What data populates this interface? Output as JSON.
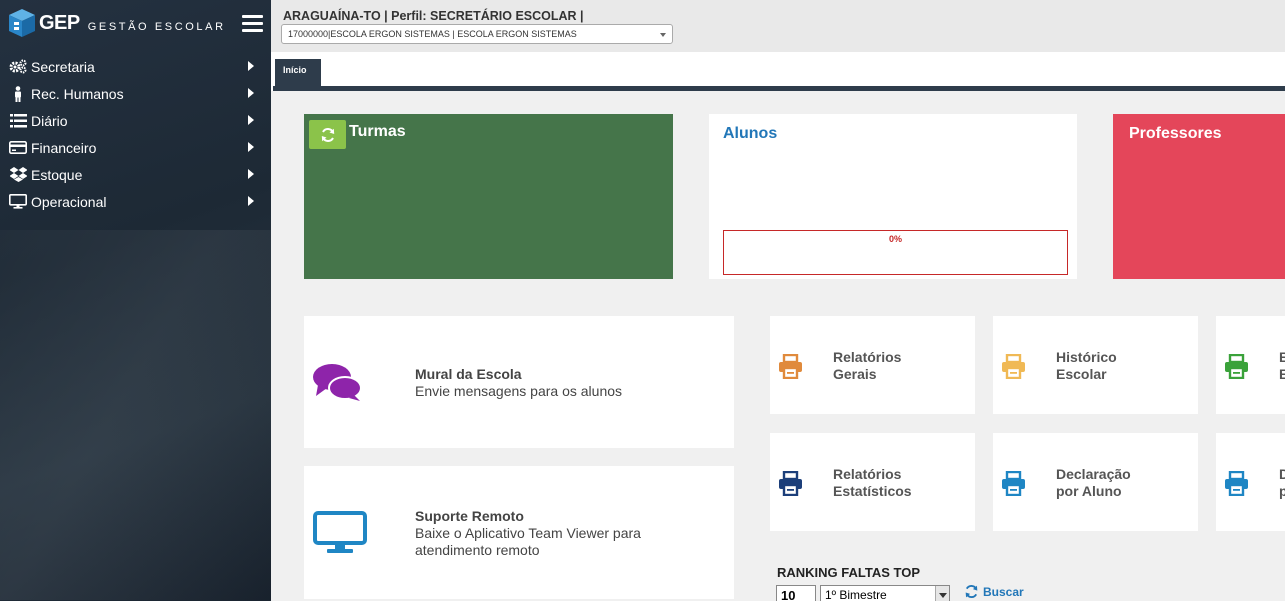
{
  "brand": {
    "logo_text": "GEP",
    "subtitle": "GESTÃO ESCOLAR"
  },
  "sidebar": {
    "items": [
      {
        "label": "Secretaria",
        "icon": "gears-icon"
      },
      {
        "label": "Rec. Humanos",
        "icon": "person-icon"
      },
      {
        "label": "Diário",
        "icon": "list-icon"
      },
      {
        "label": "Financeiro",
        "icon": "credit-card-icon"
      },
      {
        "label": "Estoque",
        "icon": "dropbox-icon"
      },
      {
        "label": "Operacional",
        "icon": "monitor-icon"
      }
    ]
  },
  "header": {
    "context": "ARAGUAÍNA-TO | Perfil: SECRETÁRIO ESCOLAR |",
    "school_select": "17000000|ESCOLA ERGON SISTEMAS | ESCOLA ERGON SISTEMAS"
  },
  "tabs": [
    {
      "label": "Início",
      "active": true
    }
  ],
  "stats": {
    "turmas": {
      "title": "Turmas",
      "color": "#45754a"
    },
    "alunos": {
      "title": "Alunos",
      "progress_label": "0%",
      "progress": 0
    },
    "professores": {
      "title": "Professores",
      "color": "#e4465a"
    }
  },
  "features": {
    "mural": {
      "title": "Mural da Escola",
      "desc": "Envie mensagens para os alunos"
    },
    "suporte": {
      "title": "Suporte Remoto",
      "desc": "Baixe o Aplicativo Team Viewer para atendimento remoto"
    }
  },
  "reports": [
    {
      "line1": "Relatórios",
      "line2": "Gerais",
      "color": "#e08a3c"
    },
    {
      "line1": "Histórico",
      "line2": "Escolar",
      "color": "#f0b955"
    },
    {
      "line1": "B",
      "line2": "E",
      "color": "#3aa23a"
    },
    {
      "line1": "Relatórios",
      "line2": "Estatísticos",
      "color": "#1c3f7a"
    },
    {
      "line1": "Declaração",
      "line2": "por Aluno",
      "color": "#1f86c4"
    },
    {
      "line1": "D",
      "line2": "p",
      "color": "#1f86c4"
    }
  ],
  "ranking": {
    "title": "RANKING FALTAS TOP",
    "count": "10",
    "period": "1º Bimestre",
    "search_label": "Buscar"
  }
}
